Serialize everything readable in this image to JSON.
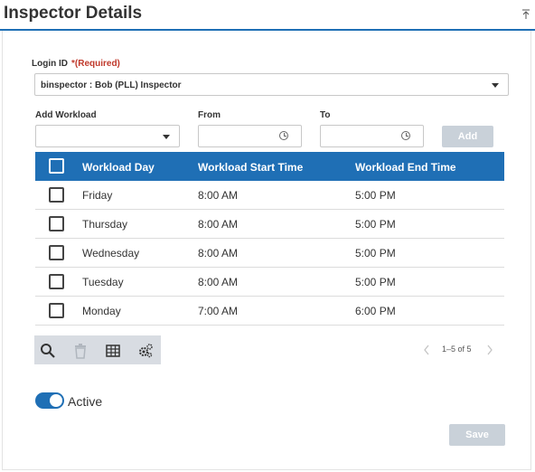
{
  "header": {
    "title": "Inspector Details"
  },
  "login": {
    "label": "Login ID",
    "required": "*(Required)",
    "value": "binspector : Bob (PLL) Inspector"
  },
  "workload": {
    "add_label": "Add Workload",
    "from_label": "From",
    "to_label": "To",
    "add_button": "Add"
  },
  "grid": {
    "columns": [
      "Workload Day",
      "Workload Start Time",
      "Workload End Time"
    ],
    "rows": [
      {
        "day": "Friday",
        "start": "8:00 AM",
        "end": "5:00 PM"
      },
      {
        "day": "Thursday",
        "start": "8:00 AM",
        "end": "5:00 PM"
      },
      {
        "day": "Wednesday",
        "start": "8:00 AM",
        "end": "5:00 PM"
      },
      {
        "day": "Tuesday",
        "start": "8:00 AM",
        "end": "5:00 PM"
      },
      {
        "day": "Monday",
        "start": "7:00 AM",
        "end": "6:00 PM"
      }
    ]
  },
  "toolbar": {
    "icons": [
      "search-icon",
      "trash-icon",
      "table-icon",
      "settings-icon"
    ]
  },
  "pager": {
    "text": "1–5 of 5"
  },
  "status": {
    "active_label": "Active",
    "active": true
  },
  "footer": {
    "save_button": "Save"
  },
  "colors": {
    "accent": "#1f6fb5",
    "required": "#c0392b",
    "disabled_button": "#c9d1d9",
    "toolbar_bg": "#d8dce2"
  }
}
